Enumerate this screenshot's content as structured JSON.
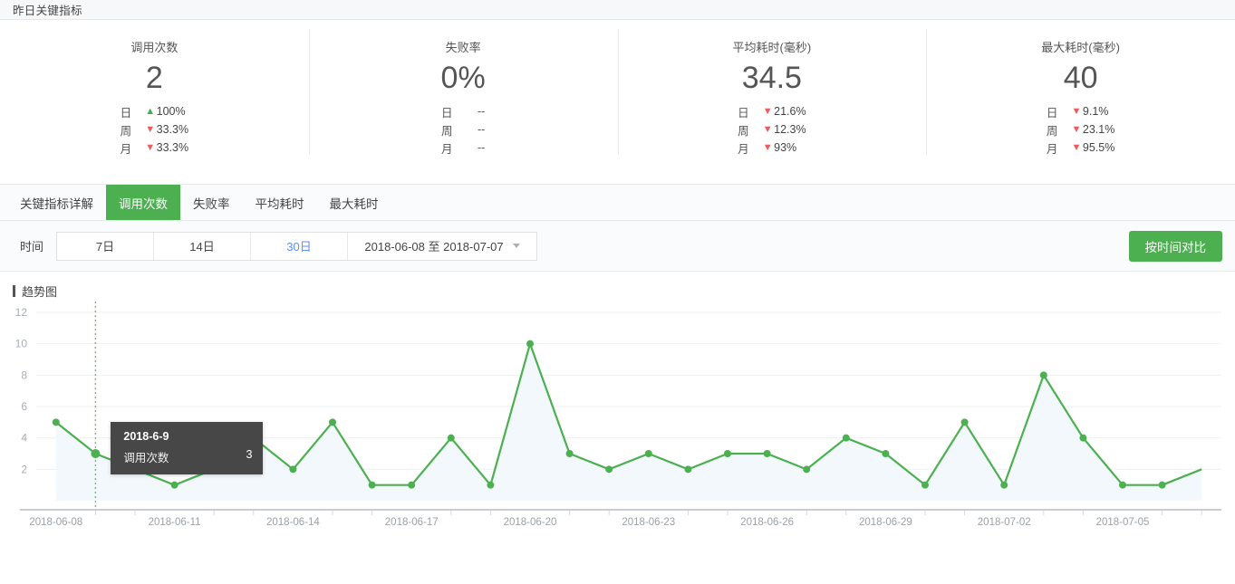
{
  "header": {
    "title": "昨日关键指标"
  },
  "metrics": [
    {
      "label": "调用次数",
      "value": "2",
      "rows": [
        {
          "period": "日",
          "dir": "up",
          "arrow": "▲",
          "delta": "100%"
        },
        {
          "period": "周",
          "dir": "down",
          "arrow": "▼",
          "delta": "33.3%"
        },
        {
          "period": "月",
          "dir": "down",
          "arrow": "▼",
          "delta": "33.3%"
        }
      ]
    },
    {
      "label": "失败率",
      "value": "0%",
      "rows": [
        {
          "period": "日",
          "dir": "none",
          "arrow": "",
          "delta": "--"
        },
        {
          "period": "周",
          "dir": "none",
          "arrow": "",
          "delta": "--"
        },
        {
          "period": "月",
          "dir": "none",
          "arrow": "",
          "delta": "--"
        }
      ]
    },
    {
      "label": "平均耗时(毫秒)",
      "value": "34.5",
      "rows": [
        {
          "period": "日",
          "dir": "down",
          "arrow": "▼",
          "delta": "21.6%"
        },
        {
          "period": "周",
          "dir": "down",
          "arrow": "▼",
          "delta": "12.3%"
        },
        {
          "period": "月",
          "dir": "down",
          "arrow": "▼",
          "delta": "93%"
        }
      ]
    },
    {
      "label": "最大耗时(毫秒)",
      "value": "40",
      "rows": [
        {
          "period": "日",
          "dir": "down",
          "arrow": "▼",
          "delta": "9.1%"
        },
        {
          "period": "周",
          "dir": "down",
          "arrow": "▼",
          "delta": "23.1%"
        },
        {
          "period": "月",
          "dir": "down",
          "arrow": "▼",
          "delta": "95.5%"
        }
      ]
    }
  ],
  "tabs": [
    {
      "label": "关键指标详解",
      "active": false
    },
    {
      "label": "调用次数",
      "active": true
    },
    {
      "label": "失败率",
      "active": false
    },
    {
      "label": "平均耗时",
      "active": false
    },
    {
      "label": "最大耗时",
      "active": false
    }
  ],
  "filter": {
    "label": "时间",
    "ranges": [
      {
        "label": "7日",
        "active": false
      },
      {
        "label": "14日",
        "active": false
      },
      {
        "label": "30日",
        "active": true
      }
    ],
    "date_range": "2018-06-08 至 2018-07-07",
    "compare_label": "按时间对比"
  },
  "chart_section": {
    "title": "趋势图"
  },
  "tooltip": {
    "title": "2018-6-9",
    "series_name": "调用次数",
    "value": "3"
  },
  "colors": {
    "accent_green": "#4cb050",
    "line_green": "#4cb050",
    "active_blue": "#5b8ff9",
    "down_red": "#f05a5a",
    "up_green": "#3fb24a",
    "tooltip_bg": "#474747"
  },
  "chart_data": {
    "type": "line",
    "title": "趋势图",
    "xlabel": "",
    "ylabel": "",
    "ylim": [
      0,
      12
    ],
    "yticks": [
      2,
      4,
      6,
      8,
      10,
      12
    ],
    "grid": true,
    "legend": "none",
    "area_fill": true,
    "highlight_index": 1,
    "x": [
      "2018-06-08",
      "2018-06-09",
      "2018-06-10",
      "2018-06-11",
      "2018-06-12",
      "2018-06-13",
      "2018-06-14",
      "2018-06-15",
      "2018-06-16",
      "2018-06-17",
      "2018-06-18",
      "2018-06-19",
      "2018-06-20",
      "2018-06-21",
      "2018-06-22",
      "2018-06-23",
      "2018-06-24",
      "2018-06-25",
      "2018-06-26",
      "2018-06-27",
      "2018-06-28",
      "2018-06-29",
      "2018-06-30",
      "2018-07-01",
      "2018-07-02",
      "2018-07-03",
      "2018-07-04",
      "2018-07-05",
      "2018-07-06",
      "2018-07-07"
    ],
    "xtick_labels": [
      "2018-06-08",
      "2018-06-11",
      "2018-06-14",
      "2018-06-17",
      "2018-06-20",
      "2018-06-23",
      "2018-06-26",
      "2018-06-29",
      "2018-07-02",
      "2018-07-05"
    ],
    "series": [
      {
        "name": "调用次数",
        "values": [
          5,
          3,
          2,
          1,
          2,
          4,
          2,
          5,
          1,
          1,
          4,
          1,
          10,
          3,
          2,
          3,
          2,
          3,
          3,
          2,
          4,
          3,
          1,
          5,
          1,
          8,
          4,
          1,
          1,
          2
        ]
      }
    ]
  }
}
